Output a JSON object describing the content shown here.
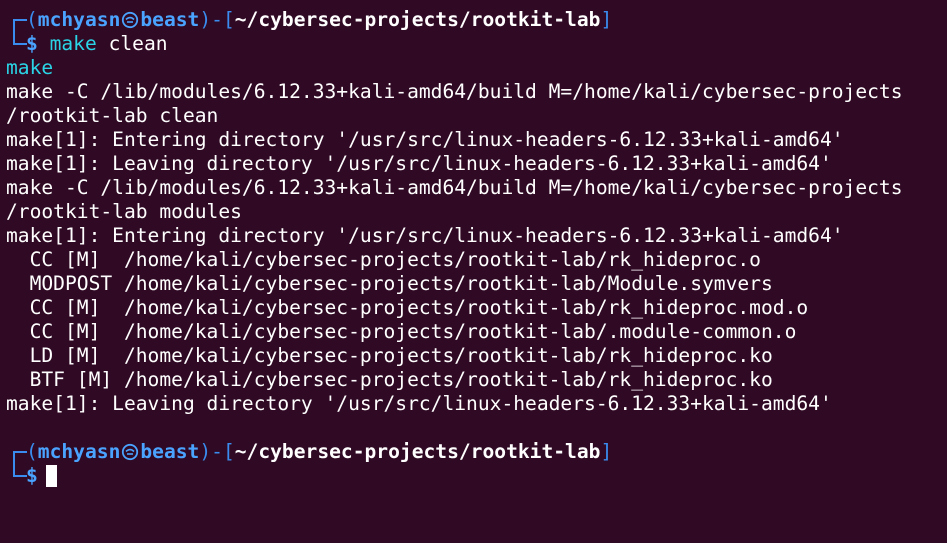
{
  "prompt": {
    "user": "mchyasn",
    "host": "beast",
    "path": "~/cybersec-projects/rootkit-lab",
    "open_paren": "(",
    "close_paren": ")",
    "dash": "-",
    "open_bracket": "[",
    "close_bracket": "]",
    "dollar": "$"
  },
  "command": {
    "name": "make",
    "arg": "clean"
  },
  "output": [
    {
      "text": "make",
      "color": "cyan"
    },
    {
      "text": "make -C /lib/modules/6.12.33+kali-amd64/build M=/home/kali/cybersec-projects",
      "color": "white"
    },
    {
      "text": "/rootkit-lab clean",
      "color": "white"
    },
    {
      "text": "make[1]: Entering directory '/usr/src/linux-headers-6.12.33+kali-amd64'",
      "color": "white"
    },
    {
      "text": "make[1]: Leaving directory '/usr/src/linux-headers-6.12.33+kali-amd64'",
      "color": "white"
    },
    {
      "text": "make -C /lib/modules/6.12.33+kali-amd64/build M=/home/kali/cybersec-projects",
      "color": "white"
    },
    {
      "text": "/rootkit-lab modules",
      "color": "white"
    },
    {
      "text": "make[1]: Entering directory '/usr/src/linux-headers-6.12.33+kali-amd64'",
      "color": "white"
    },
    {
      "text": "  CC [M]  /home/kali/cybersec-projects/rootkit-lab/rk_hideproc.o",
      "color": "white"
    },
    {
      "text": "  MODPOST /home/kali/cybersec-projects/rootkit-lab/Module.symvers",
      "color": "white"
    },
    {
      "text": "  CC [M]  /home/kali/cybersec-projects/rootkit-lab/rk_hideproc.mod.o",
      "color": "white"
    },
    {
      "text": "  CC [M]  /home/kali/cybersec-projects/rootkit-lab/.module-common.o",
      "color": "white"
    },
    {
      "text": "  LD [M]  /home/kali/cybersec-projects/rootkit-lab/rk_hideproc.ko",
      "color": "white"
    },
    {
      "text": "  BTF [M] /home/kali/cybersec-projects/rootkit-lab/rk_hideproc.ko",
      "color": "white"
    },
    {
      "text": "make[1]: Leaving directory '/usr/src/linux-headers-6.12.33+kali-amd64'",
      "color": "white"
    }
  ],
  "colors": {
    "background": "#300a24",
    "prompt_blue": "#3a8cef",
    "user_blue": "#4aa3ff",
    "command_cyan": "#2ad4e6",
    "text": "#ffffff"
  },
  "icons": {
    "separator": "kali-skull-icon"
  }
}
